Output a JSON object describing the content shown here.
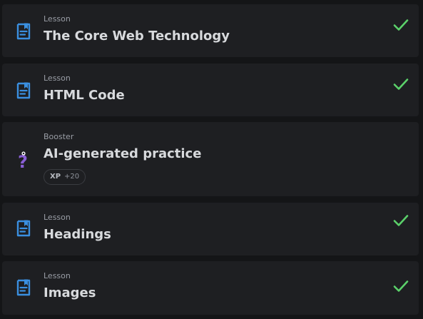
{
  "items": [
    {
      "kind": "Lesson",
      "title": "The Core Web Technology",
      "completed": true,
      "icon": "lesson-doc-icon"
    },
    {
      "kind": "Lesson",
      "title": "HTML Code",
      "completed": true,
      "icon": "lesson-doc-icon"
    },
    {
      "kind": "Booster",
      "title": "AI-generated practice",
      "completed": false,
      "icon": "question-mark-icon",
      "badge": {
        "label": "XP",
        "value": "+20"
      }
    },
    {
      "kind": "Lesson",
      "title": "Headings",
      "completed": true,
      "icon": "lesson-doc-icon"
    },
    {
      "kind": "Lesson",
      "title": "Images",
      "completed": true,
      "icon": "lesson-doc-icon"
    }
  ],
  "colors": {
    "page_background": "#141517",
    "card_background": "#1e1f22",
    "lesson_icon": "#3a8fe0",
    "booster_icon": "#8a5fd6",
    "check": "#5bd16a",
    "title_text": "#d8dadd",
    "kind_text": "#9a9ea6"
  }
}
